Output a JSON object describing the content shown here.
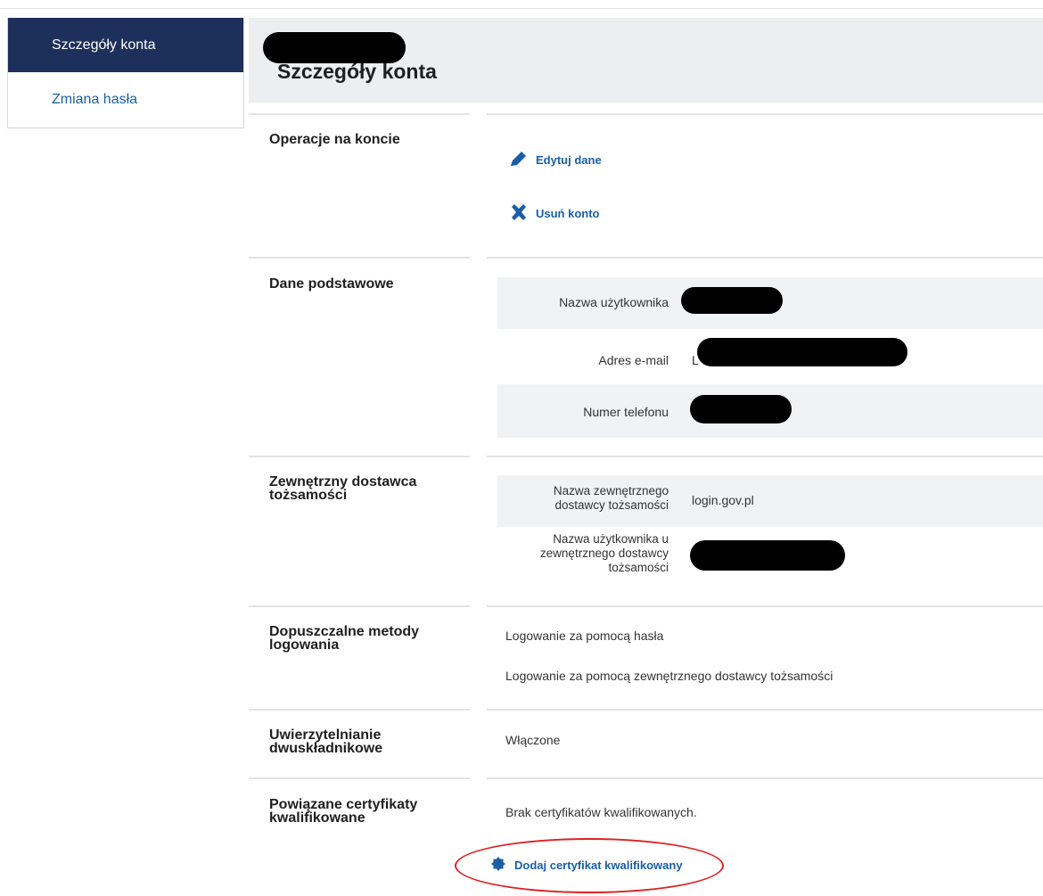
{
  "sidebar": {
    "items": [
      {
        "label": "Szczegóły konta",
        "active": true
      },
      {
        "label": "Zmiana hasła",
        "active": false
      }
    ]
  },
  "header": {
    "title": "Szczegóły konta"
  },
  "sections": {
    "operations": {
      "title": "Operacje na koncie",
      "edit_label": "Edytuj dane",
      "delete_label": "Usuń konto"
    },
    "basic": {
      "title": "Dane podstawowe",
      "username_label": "Nazwa użytkownika",
      "email_label": "Adres e-mail",
      "email_prefix": "L",
      "phone_label": "Numer telefonu"
    },
    "idp": {
      "title": "Zewnętrzny dostawca tożsamości",
      "name_label": "Nazwa zewnętrznego dostawcy tożsamości",
      "name_value": "login.gov.pl",
      "user_label": "Nazwa użytkownika u zewnętrznego dostawcy tożsamości"
    },
    "login_methods": {
      "title": "Dopuszczalne metody logowania",
      "methods": [
        "Logowanie za pomocą hasła",
        "Logowanie za pomocą zewnętrznego dostawcy tożsamości"
      ]
    },
    "two_factor": {
      "title": "Uwierzytelnianie dwuskładnikowe",
      "status": "Włączone"
    },
    "certificates": {
      "title": "Powiązane certyfikaty kwalifikowane",
      "empty_text": "Brak certyfikatów kwalifikowanych.",
      "add_label": "Dodaj certyfikat kwalifikowany"
    }
  },
  "colors": {
    "sidebar_active": "#1d2f5b",
    "link": "#1a5fa5",
    "annotation": "#dd2222"
  }
}
